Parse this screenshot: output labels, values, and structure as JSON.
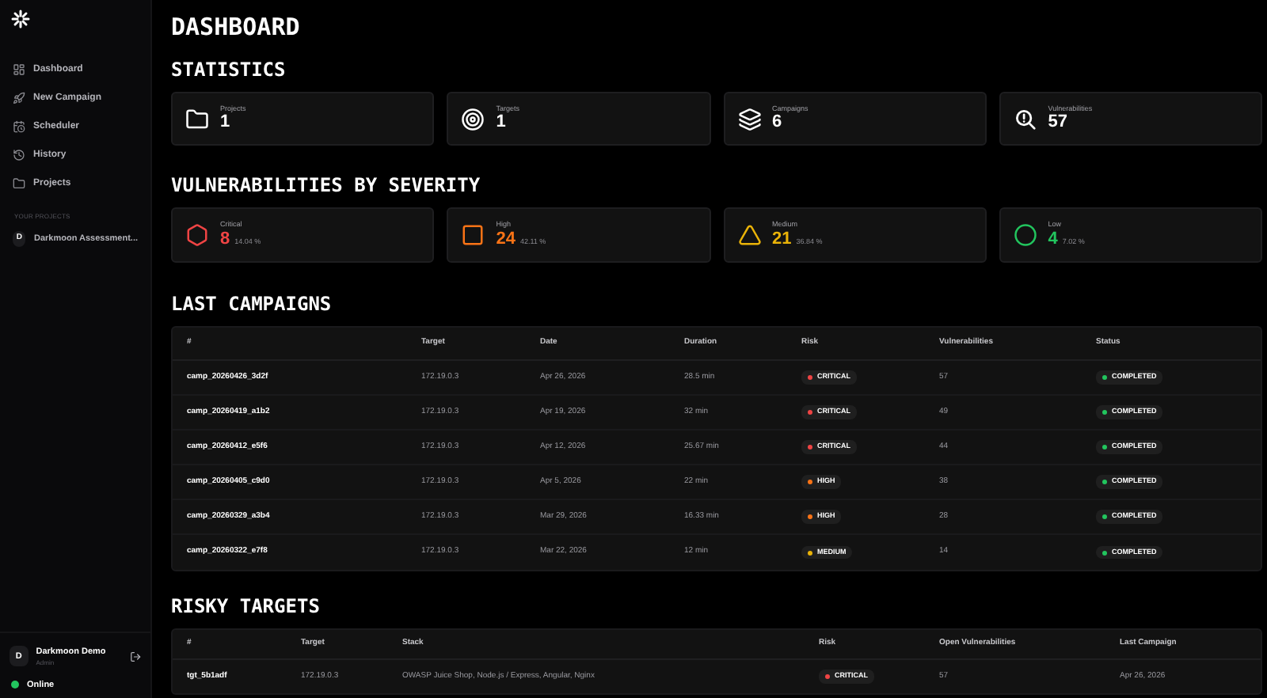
{
  "sidebar": {
    "items": [
      {
        "label": "Dashboard",
        "kind": "dashboard"
      },
      {
        "label": "New Campaign",
        "kind": "rocket"
      },
      {
        "label": "Scheduler",
        "kind": "calendar"
      },
      {
        "label": "History",
        "kind": "history"
      },
      {
        "label": "Projects",
        "kind": "folder"
      }
    ],
    "section_label": "YOUR PROJECTS",
    "projects": [
      {
        "initial": "D",
        "name": "Darkmoon Assessment..."
      }
    ],
    "user": {
      "initial": "D",
      "name": "Darkmoon Demo",
      "role": "Admin"
    },
    "status": {
      "label": "Online",
      "color": "#22c55e"
    }
  },
  "title": "DASHBOARD",
  "statistics": {
    "heading": "STATISTICS",
    "cards": [
      {
        "kind": "folder",
        "label": "Projects",
        "value": "1"
      },
      {
        "kind": "target",
        "label": "Targets",
        "value": "1"
      },
      {
        "kind": "layers",
        "label": "Campaigns",
        "value": "6"
      },
      {
        "kind": "search-alert",
        "label": "Vulnerabilities",
        "value": "57"
      }
    ]
  },
  "severity": {
    "heading": "VULNERABILITIES BY SEVERITY",
    "cards": [
      {
        "kind": "hexagon",
        "label": "Critical",
        "value": "8",
        "percent": "14.04 %",
        "color": "#ef4444"
      },
      {
        "kind": "square",
        "label": "High",
        "value": "24",
        "percent": "42.11 %",
        "color": "#f97316"
      },
      {
        "kind": "triangle",
        "label": "Medium",
        "value": "21",
        "percent": "36.84 %",
        "color": "#eab308"
      },
      {
        "kind": "circle",
        "label": "Low",
        "value": "4",
        "percent": "7.02 %",
        "color": "#22c55e"
      }
    ]
  },
  "last_campaigns": {
    "heading": "LAST CAMPAIGNS",
    "columns": [
      "#",
      "Target",
      "Date",
      "Duration",
      "Risk",
      "Vulnerabilities",
      "Status"
    ],
    "rows": [
      {
        "id": "camp_20260426_3d2f",
        "target": "172.19.0.3",
        "date": "Apr 26, 2026",
        "duration": "28.5 min",
        "risk": {
          "label": "CRITICAL",
          "color": "#ef4444"
        },
        "vulnerabilities": "57",
        "status": {
          "label": "COMPLETED",
          "color": "#22c55e"
        }
      },
      {
        "id": "camp_20260419_a1b2",
        "target": "172.19.0.3",
        "date": "Apr 19, 2026",
        "duration": "32 min",
        "risk": {
          "label": "CRITICAL",
          "color": "#ef4444"
        },
        "vulnerabilities": "49",
        "status": {
          "label": "COMPLETED",
          "color": "#22c55e"
        }
      },
      {
        "id": "camp_20260412_e5f6",
        "target": "172.19.0.3",
        "date": "Apr 12, 2026",
        "duration": "25.67 min",
        "risk": {
          "label": "CRITICAL",
          "color": "#ef4444"
        },
        "vulnerabilities": "44",
        "status": {
          "label": "COMPLETED",
          "color": "#22c55e"
        }
      },
      {
        "id": "camp_20260405_c9d0",
        "target": "172.19.0.3",
        "date": "Apr 5, 2026",
        "duration": "22 min",
        "risk": {
          "label": "HIGH",
          "color": "#f97316"
        },
        "vulnerabilities": "38",
        "status": {
          "label": "COMPLETED",
          "color": "#22c55e"
        }
      },
      {
        "id": "camp_20260329_a3b4",
        "target": "172.19.0.3",
        "date": "Mar 29, 2026",
        "duration": "16.33 min",
        "risk": {
          "label": "HIGH",
          "color": "#f97316"
        },
        "vulnerabilities": "28",
        "status": {
          "label": "COMPLETED",
          "color": "#22c55e"
        }
      },
      {
        "id": "camp_20260322_e7f8",
        "target": "172.19.0.3",
        "date": "Mar 22, 2026",
        "duration": "12 min",
        "risk": {
          "label": "MEDIUM",
          "color": "#eab308"
        },
        "vulnerabilities": "14",
        "status": {
          "label": "COMPLETED",
          "color": "#22c55e"
        }
      }
    ]
  },
  "risky_targets": {
    "heading": "RISKY TARGETS",
    "columns": [
      "#",
      "Target",
      "Stack",
      "Risk",
      "Open Vulnerabilities",
      "Last Campaign"
    ],
    "rows": [
      {
        "id": "tgt_5b1adf",
        "target": "172.19.0.3",
        "stack": "OWASP Juice Shop, Node.js / Express, Angular, Nginx",
        "risk": {
          "label": "CRITICAL",
          "color": "#ef4444"
        },
        "open_vulnerabilities": "57",
        "last_campaign": "Apr 26, 2026"
      }
    ]
  }
}
